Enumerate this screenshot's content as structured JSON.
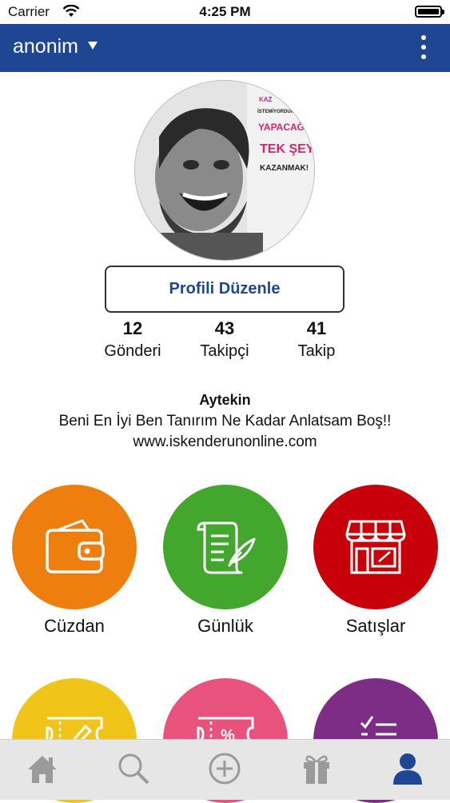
{
  "status_bar": {
    "carrier": "Carrier",
    "time": "4:25 PM"
  },
  "nav": {
    "username": "anonim"
  },
  "profile": {
    "edit_button": "Profili Düzenle",
    "stats": [
      {
        "value": "12",
        "label": "Gönderi"
      },
      {
        "value": "43",
        "label": "Takipçi"
      },
      {
        "value": "41",
        "label": "Takip"
      }
    ],
    "name": "Aytekin",
    "bio": "Beni En İyi Ben Tanırım Ne Kadar Anlatsam Boş!!",
    "website": "www.iskenderunonline.com",
    "avatar_text": [
      "KAZ",
      "İSTEMİYORDUM",
      "YAPACAĞI",
      "TEK ŞEY",
      "KAZANMAK!"
    ]
  },
  "menu": [
    {
      "label": "Cüzdan",
      "color": "#ee7f0f",
      "icon": "wallet-icon"
    },
    {
      "label": "Günlük",
      "color": "#44a72d",
      "icon": "scroll-quill-icon"
    },
    {
      "label": "Satışlar",
      "color": "#c8000a",
      "icon": "store-icon"
    },
    {
      "label": "",
      "color": "#f0c419",
      "icon": "ticket-edit-icon"
    },
    {
      "label": "",
      "color": "#e8527d",
      "icon": "discount-ticket-icon"
    },
    {
      "label": "",
      "color": "#7d2d86",
      "icon": "checklist-icon"
    }
  ],
  "tabbar": {
    "tabs": [
      {
        "icon": "home-icon"
      },
      {
        "icon": "search-icon"
      },
      {
        "icon": "add-icon"
      },
      {
        "icon": "gift-icon"
      },
      {
        "icon": "profile-icon",
        "active": true
      }
    ],
    "active_color": "#1f4693",
    "inactive_color": "#9a9a9a"
  }
}
